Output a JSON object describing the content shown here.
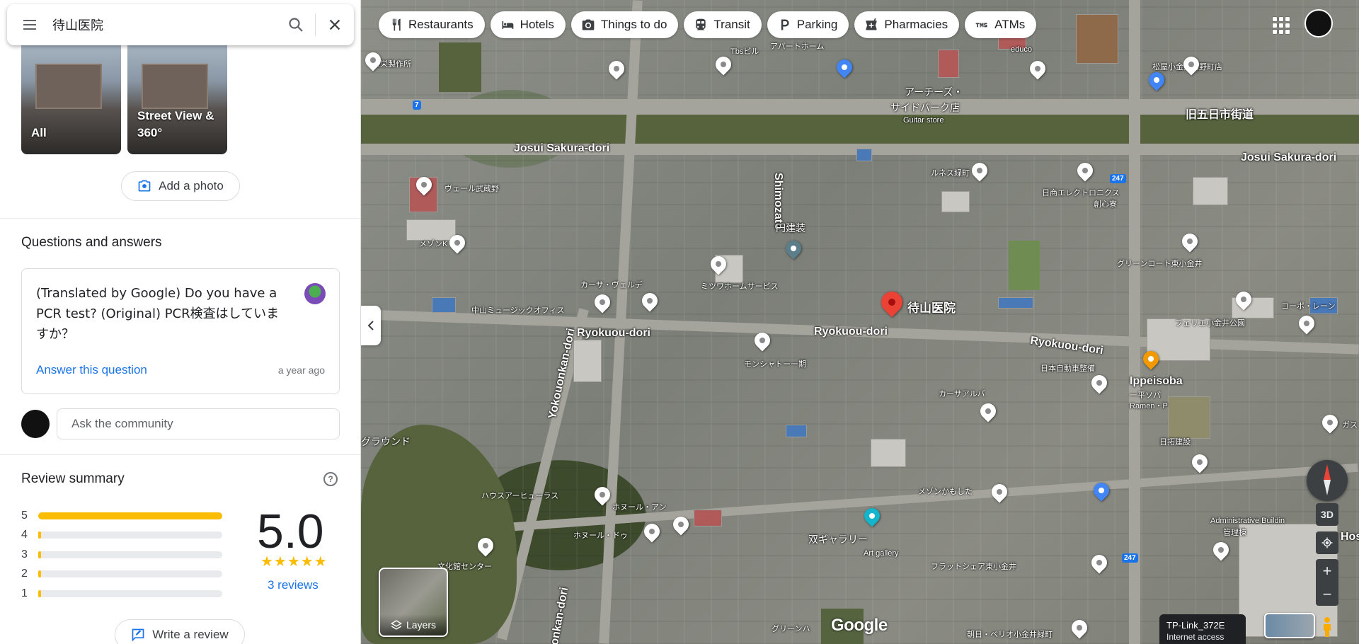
{
  "search": {
    "query": "待山医院"
  },
  "photos": [
    {
      "label": "All"
    },
    {
      "label": "Street View & 360°"
    }
  ],
  "add_photo_label": "Add a photo",
  "qa": {
    "title": "Questions and answers",
    "question": "(Translated by Google) Do you have a PCR test? (Original) PCR検査はしていますか？",
    "answer_label": "Answer this question",
    "time": "a year ago",
    "ask_placeholder": "Ask the community"
  },
  "review_summary": {
    "title": "Review summary",
    "help_icon": "?",
    "rows": [
      {
        "star": "5",
        "fraction": 1.0
      },
      {
        "star": "4",
        "fraction": 0
      },
      {
        "star": "3",
        "fraction": 0
      },
      {
        "star": "2",
        "fraction": 0
      },
      {
        "star": "1",
        "fraction": 0
      }
    ],
    "rating": "5.0",
    "stars": "★★★★★",
    "reviews_label": "3 reviews",
    "write_review_label": "Write a review"
  },
  "chips": [
    {
      "label": "Restaurants",
      "icon": "fork-knife-icon"
    },
    {
      "label": "Hotels",
      "icon": "bed-icon"
    },
    {
      "label": "Things to do",
      "icon": "camera-icon"
    },
    {
      "label": "Transit",
      "icon": "train-icon"
    },
    {
      "label": "Parking",
      "icon": "parking-icon"
    },
    {
      "label": "Pharmacies",
      "icon": "pharmacy-icon"
    },
    {
      "label": "ATMs",
      "icon": "atm-icon"
    }
  ],
  "map": {
    "labels": {
      "kyoeiseisakusho": "共栄製作所",
      "tbs": "Tbsビル",
      "apartment": "アパートホーム",
      "educo": "educo",
      "matsuya": "松屋小金井関野町店",
      "archies": "アーチーズ・",
      "sidepark": "サイドパーク店",
      "guitar": "Guitar store",
      "kyu_itsukaichi": "旧五日市街道",
      "josui1": "Josui Sakura-dori",
      "josui2": "Josui Sakura-dori",
      "veil": "ヴェール武蔵野",
      "tisc": "ルネス緑町",
      "nissho": "日商エレクトロニクス",
      "soshinryo": "創心寮",
      "maison_k": "メゾンK",
      "shimozato": "Shimozato",
      "enkensou": "円建装",
      "greencourt": "グリーンコート東小金井",
      "casa": "カーサ・ヴェルデ",
      "mitsuwa": "ミツワホームサービス",
      "nakayama": "中山ミュージックオフィス",
      "ryokuou1": "Ryokuou-dori",
      "ryokuou2": "Ryokuou-dori",
      "ryokuou3": "Ryokuou-dori",
      "place_name": "待山医院",
      "felie": "フェリエ小金井公園",
      "koopo": "コーポ・レーン",
      "monchateau": "モンシャトー一期",
      "nippon_jidosha": "日本自動車整備",
      "ippei": "Ippeisoba",
      "ippei2": "一平ソバ",
      "ramen": "Ramen・P",
      "yokouonkan": "Yokouonkan-dori",
      "casa_alba": "カーサアルバ",
      "ground": "グラウンド",
      "nittaku": "日拓建設",
      "heights": "ハウスアーヒューラス",
      "hoheros": "ホヌール・アン",
      "maison_tsukasa": "メゾンかもした",
      "administrative": "Administrative Buildin",
      "kanrito": "管理棟",
      "sou_gallery": "双ギャラリー",
      "art_gallery": "Art gallery",
      "bunka": "文化館センター",
      "flat": "フラットシェア東小金井",
      "hoheru2": "ホヌール・ドゥ",
      "green_haru": "グリーンハ",
      "asahi": "朝日・ベリオ小金井緑町",
      "onkan_dori": "onkan-dori",
      "gas": "ガス",
      "hos": "Hos",
      "route_247": "247",
      "route_7": "7"
    },
    "layers_label": "Layers",
    "google_logo": "Google",
    "wifi_name": "TP-Link_372E",
    "wifi_sub": "Internet access",
    "btn_3d": "3D"
  }
}
